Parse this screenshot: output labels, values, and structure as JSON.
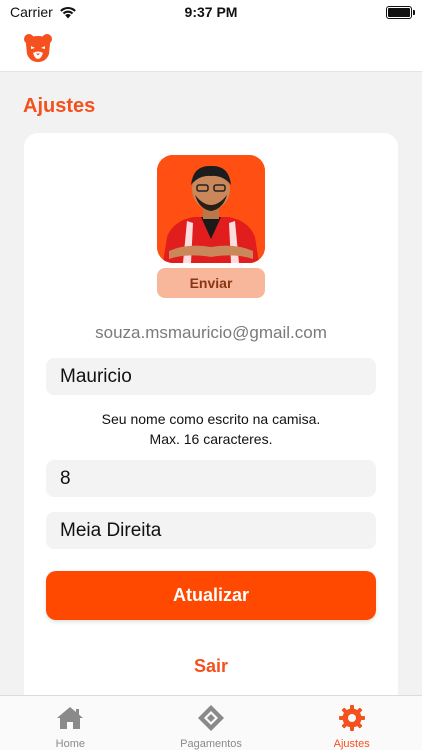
{
  "status_bar": {
    "carrier": "Carrier",
    "time": "9:37 PM",
    "battery_level": 1.0
  },
  "header": {
    "logo_icon": "bear-logo-icon",
    "brand_color": "#f4511e"
  },
  "page": {
    "title": "Ajustes"
  },
  "profile": {
    "avatar_icon": "avatar-photo",
    "send_label": "Enviar",
    "email": "souza.msmauricio@gmail.com",
    "name_value": "Mauricio",
    "name_hint_line1": "Seu nome como escrito na camisa.",
    "name_hint_line2": "Max. 16 caracteres.",
    "number_value": "8",
    "position_value": "Meia Direita",
    "update_label": "Atualizar",
    "logout_label": "Sair"
  },
  "tabs": [
    {
      "label": "Home",
      "icon": "home-icon",
      "active": false
    },
    {
      "label": "Pagamentos",
      "icon": "payments-icon",
      "active": false
    },
    {
      "label": "Ajustes",
      "icon": "gear-icon",
      "active": true
    }
  ],
  "colors": {
    "accent": "#ff4800",
    "accent_light": "#f8b79b",
    "inactive_tab": "#8a8a8a"
  }
}
